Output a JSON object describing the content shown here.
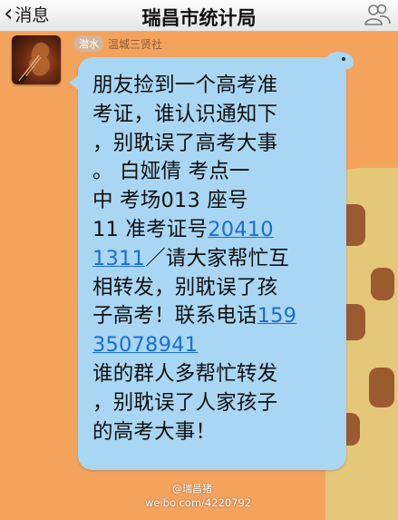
{
  "nav": {
    "back_label": "消息",
    "back_chevron": "‹",
    "title": "瑞昌市统计局",
    "right_icon": "contact-group-icon"
  },
  "sender": {
    "badge": "潜水",
    "name": "温城三贤社",
    "avatar_icon": "violin-avatar"
  },
  "message": {
    "lines": [
      [
        {
          "text": "朋友捡到一个高考准"
        }
      ],
      [
        {
          "text": "考证，谁认识通知下"
        }
      ],
      [
        {
          "text": "，别耽误了高考大事"
        }
      ],
      [
        {
          "text": "。  白娅倩  考点一"
        }
      ],
      [
        {
          "text": "中  考场013   座号"
        }
      ],
      [
        {
          "text": "11   准考证号"
        },
        {
          "text": "20410",
          "link": true
        }
      ],
      [
        {
          "text": "1311",
          "link": true
        },
        {
          "text": "／请大家帮忙互"
        }
      ],
      [
        {
          "text": "相转发，别耽误了孩"
        }
      ],
      [
        {
          "text": "子高考！联系电话"
        },
        {
          "text": "159",
          "link": true
        }
      ],
      [
        {
          "text": "35078941",
          "link": true
        }
      ],
      [
        {
          "text": "谁的群人多帮忙转发"
        }
      ],
      [
        {
          "text": "，别耽误了人家孩子"
        }
      ],
      [
        {
          "text": "的高考大事！"
        }
      ]
    ]
  },
  "watermark": {
    "handle": "@瑞昌猪",
    "url": "weibo.com/4220792"
  },
  "colors": {
    "background": "#f4a35d",
    "bubble": "#a9d6f3",
    "link": "#1a6fd0"
  }
}
